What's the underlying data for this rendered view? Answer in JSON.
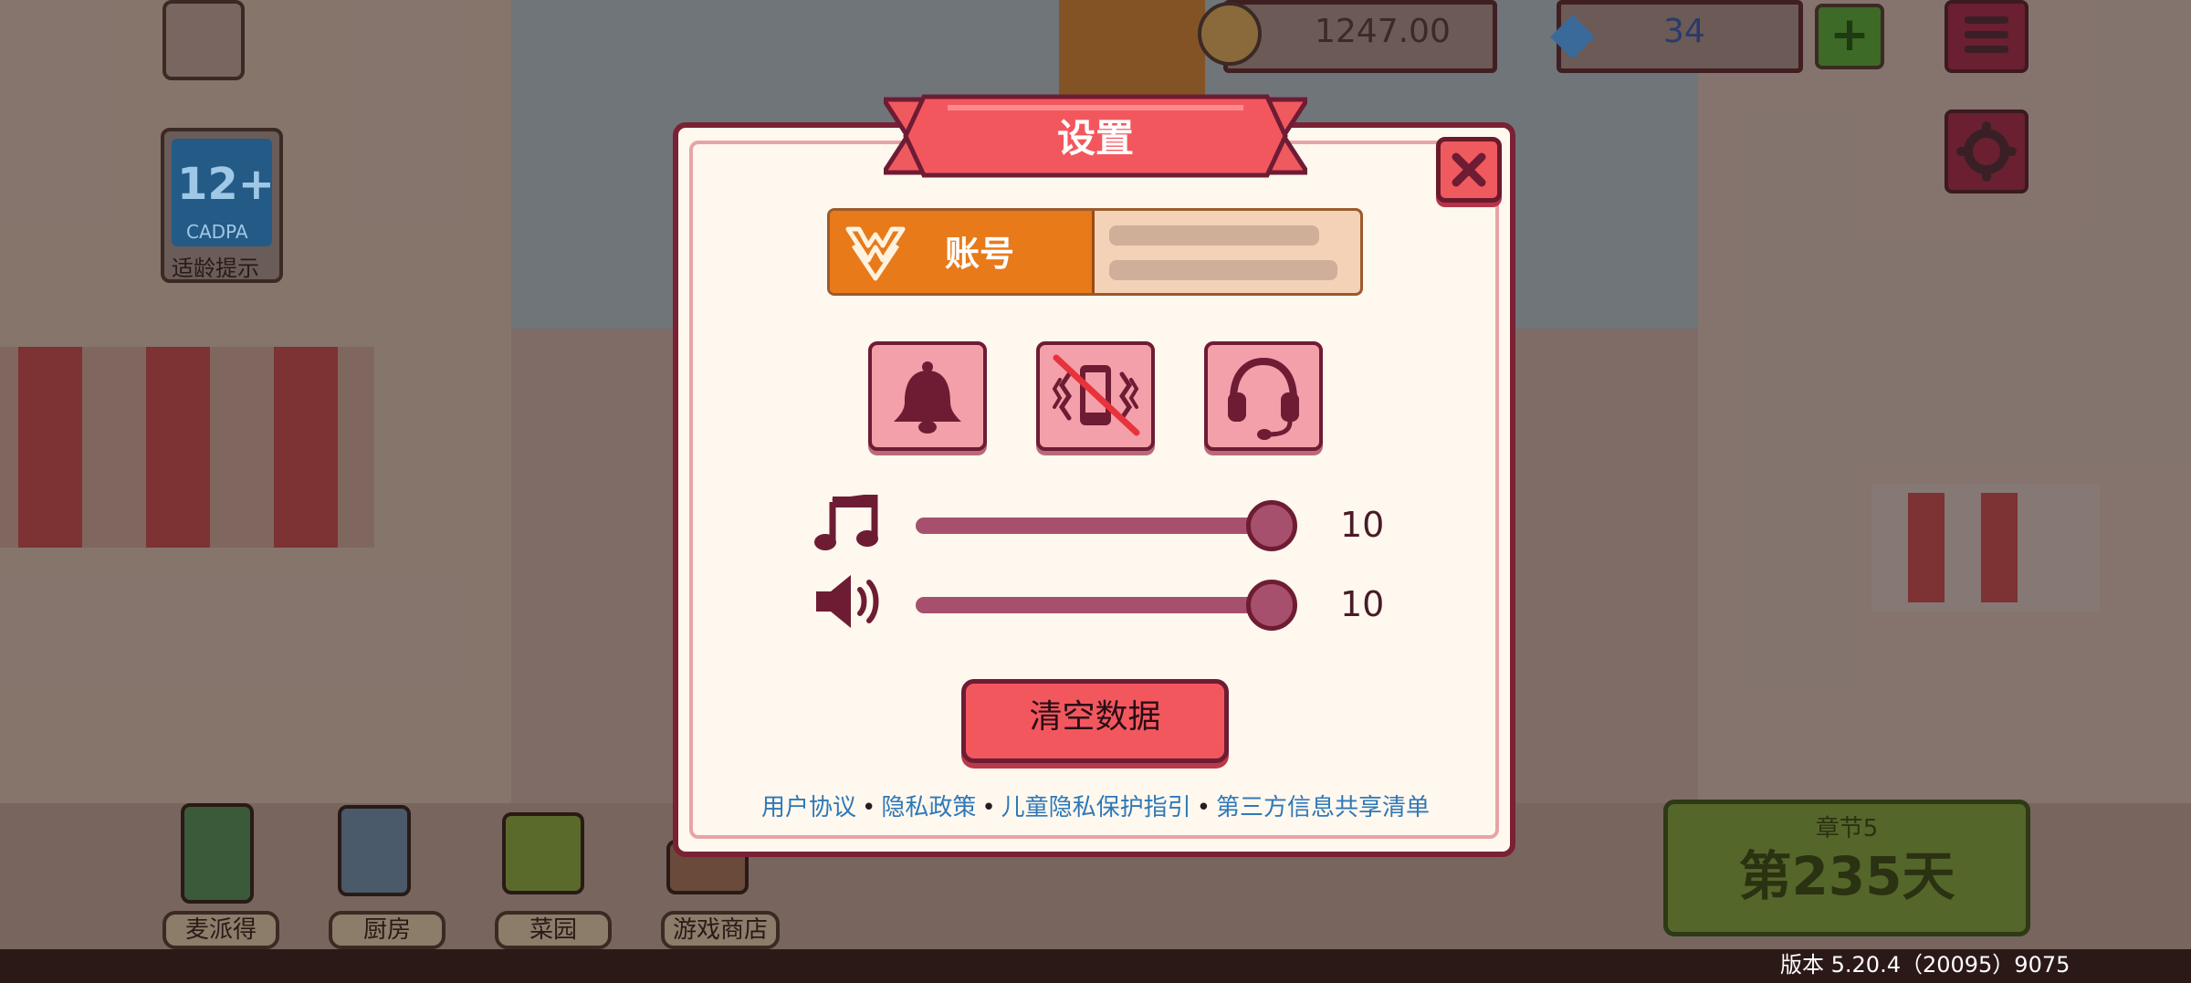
{
  "hud": {
    "coins": "1247.00",
    "gems": "34",
    "plus_label": "+",
    "age_rating": {
      "number": "12+",
      "org": "CADPA",
      "caption": "适龄提示"
    }
  },
  "bottom_nav": [
    {
      "label": "麦派得",
      "icon": "phone-icon"
    },
    {
      "label": "厨房",
      "icon": "kitchen-icon"
    },
    {
      "label": "菜园",
      "icon": "sprout-icon"
    },
    {
      "label": "游戏商店",
      "icon": "shop-icon"
    }
  ],
  "chapter": {
    "label": "章节5",
    "day": "第235天"
  },
  "dialog": {
    "title": "设置",
    "account_label": "账号",
    "toggles": [
      {
        "icon": "bell-icon",
        "state": "on"
      },
      {
        "icon": "vibration-icon",
        "state": "off"
      },
      {
        "icon": "headset-icon",
        "state": "on"
      }
    ],
    "music": {
      "icon": "music-note-icon",
      "level": 10,
      "max": 10,
      "value_text": "10"
    },
    "sound": {
      "icon": "speaker-icon",
      "level": 10,
      "max": 10,
      "value_text": "10"
    },
    "clear_label": "清空数据",
    "links": [
      "用户协议",
      "隐私政策",
      "儿童隐私保护指引",
      "第三方信息共享清单"
    ],
    "link_separator": "•"
  },
  "version": "版本 5.20.4（20095）9075",
  "colors": {
    "accent_red": "#f3575e",
    "dialog_bg": "#fff8ee",
    "border_dark": "#6e1c34",
    "account_orange": "#e87a1a",
    "link_blue": "#2f78b8"
  }
}
